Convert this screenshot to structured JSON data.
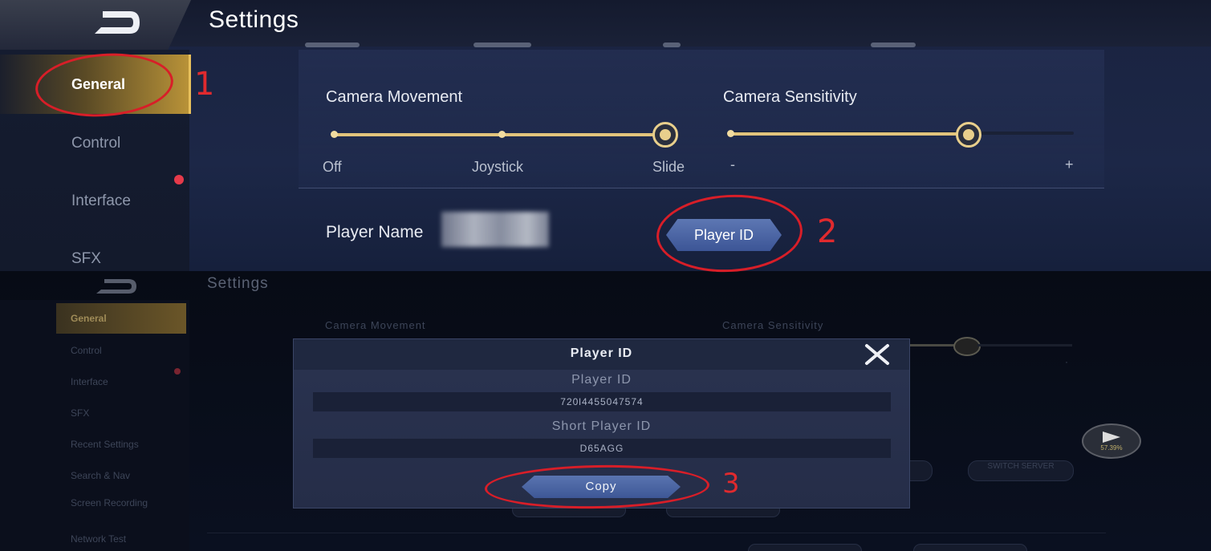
{
  "top": {
    "title": "Settings",
    "sidebar": {
      "items": [
        {
          "label": "General",
          "active": true
        },
        {
          "label": "Control"
        },
        {
          "label": "Interface",
          "has_dot": true
        },
        {
          "label": "SFX"
        }
      ]
    },
    "camera_movement": {
      "label": "Camera Movement",
      "options": [
        "Off",
        "Joystick",
        "Slide"
      ],
      "selected": "Slide"
    },
    "camera_sensitivity": {
      "label": "Camera Sensitivity",
      "min_label": "-",
      "max_label": "+",
      "level": 0.69
    },
    "player_name_label": "Player Name",
    "player_id_button": "Player ID"
  },
  "bottom": {
    "title": "Settings",
    "sidebar": {
      "items": [
        {
          "label": "General",
          "active": true
        },
        {
          "label": "Control"
        },
        {
          "label": "Interface",
          "has_dot": true
        },
        {
          "label": "SFX"
        },
        {
          "label": "Recent Settings"
        },
        {
          "label": "Search & Nav"
        },
        {
          "label": "Screen Recording"
        },
        {
          "label": "Network Test"
        }
      ]
    },
    "background_labels": {
      "camera_movement": "Camera Movement",
      "camera_sensitivity": "Camera Sensitivity",
      "switch_server": "SWITCH SERVER",
      "play_badge": "57.39%"
    },
    "modal": {
      "title": "Player ID",
      "player_id_label": "Player ID",
      "player_id_value": "720l4455047574",
      "short_id_label": "Short Player ID",
      "short_id_value": "D65AGG",
      "copy_button": "Copy"
    }
  },
  "annotations": {
    "step1": "1",
    "step2": "2",
    "step3": "3",
    "color": "#d81e28"
  }
}
